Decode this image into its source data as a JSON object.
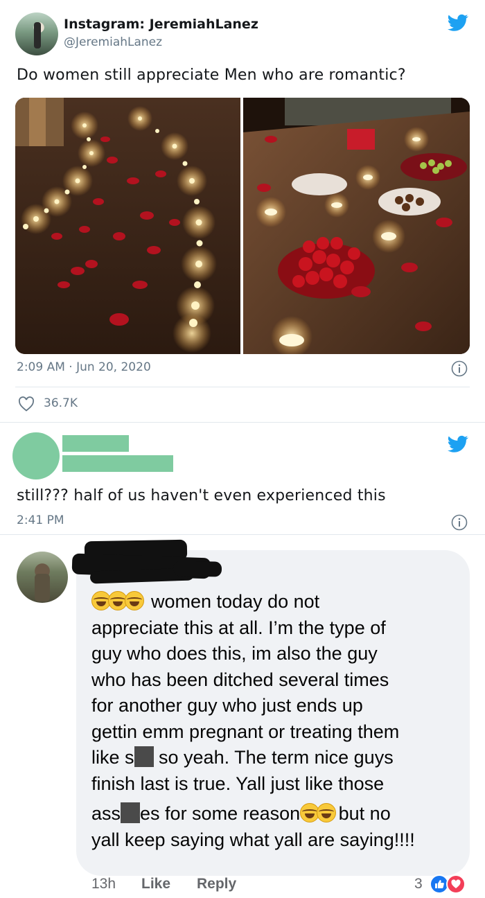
{
  "tweet1": {
    "name": "Instagram: JeremiahLanez",
    "handle": "@JeremiahLanez",
    "text": "Do women still appreciate Men who are romantic?",
    "timestamp": "2:09 AM · Jun 20, 2020",
    "likes": "36.7K"
  },
  "tweet2": {
    "text": "still??? half of us haven't even experienced this",
    "timestamp": "2:41 PM"
  },
  "fb_comment": {
    "line1": "women today do not",
    "line2": "appreciate this at all. I’m the type of",
    "line3": "guy who does this, im also the guy",
    "line4": "who has been ditched several times",
    "line5": "for another guy who just ends up",
    "line6": "gettin emm pregnant or treating them",
    "line7a": "like s",
    "line7b": " so yeah. The term nice guys",
    "line8": "finish last is true. Yall just like those",
    "line9a": "ass",
    "line9b": "es for some reason",
    "line9c": " but no",
    "line10": "yall keep saying what yall are saying!!!!",
    "time": "13h",
    "like_label": "Like",
    "reply_label": "Reply",
    "reaction_count": "3"
  },
  "icons": {
    "twitter": "twitter-bird-icon",
    "info": "info-icon",
    "heart": "heart-icon",
    "emoji": "laughing-emoji-icon",
    "like_reaction": "thumbs-up-icon",
    "love_reaction": "heart-reaction-icon"
  },
  "colors": {
    "twitter_blue": "#1da1f2",
    "redaction_green": "#7fcba0",
    "secondary_text": "#657786",
    "fb_bubble": "#f0f2f5"
  }
}
